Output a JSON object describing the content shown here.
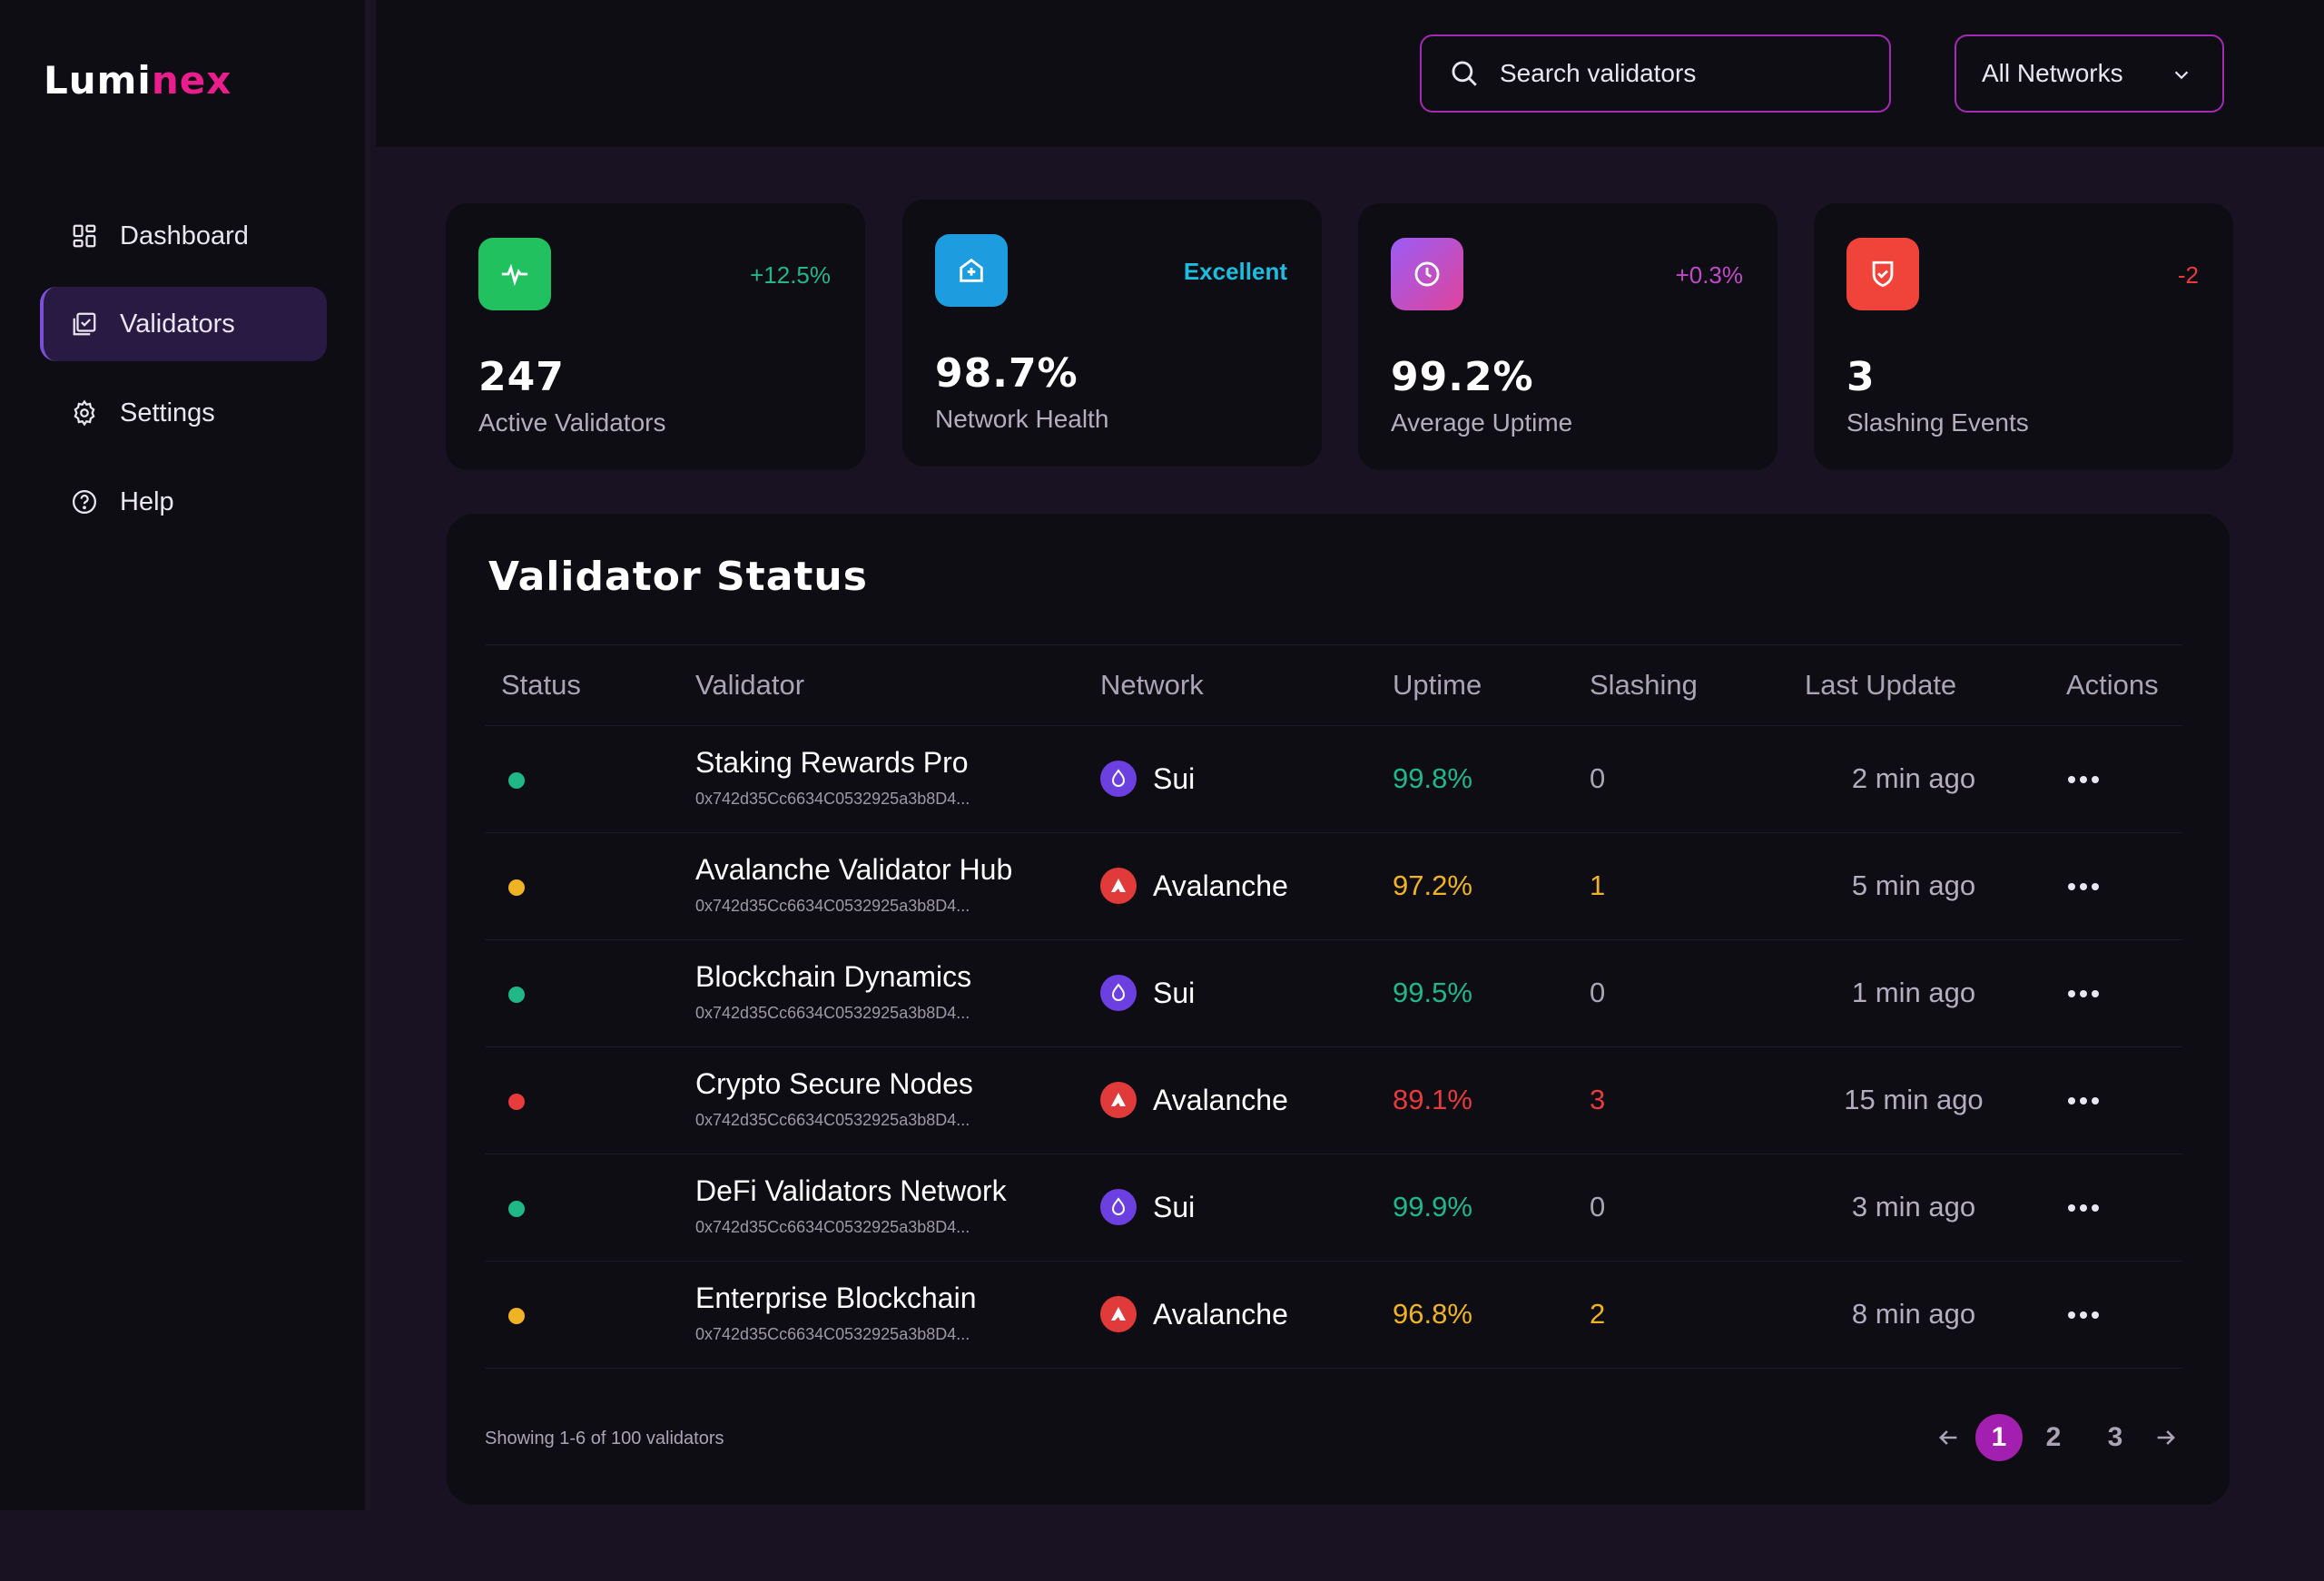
{
  "brand": {
    "name_part1": "Lumi",
    "name_part2": "nex",
    "accent_color": "#e91e8c"
  },
  "sidebar": {
    "items": [
      {
        "label": "Dashboard",
        "icon": "dashboard-icon",
        "active": false
      },
      {
        "label": "Validators",
        "icon": "validators-icon",
        "active": true
      },
      {
        "label": "Settings",
        "icon": "settings-icon",
        "active": false
      },
      {
        "label": "Help",
        "icon": "help-icon",
        "active": false
      }
    ]
  },
  "header": {
    "search_placeholder": "Search validators",
    "network_select": "All Networks"
  },
  "stats": [
    {
      "value": "247",
      "label": "Active Validators",
      "change": "+12.5%",
      "change_color": "#1fb886",
      "icon": "activity-icon",
      "icon_bg": "#22c160"
    },
    {
      "value": "98.7%",
      "label": "Network Health",
      "change": "Excellent",
      "change_color": "#1bbde0",
      "icon": "health-icon",
      "icon_bg": "#1d9de0"
    },
    {
      "value": "99.2%",
      "label": "Average Uptime",
      "change": "+0.3%",
      "change_color": "#c04ac9",
      "icon": "clock-icon",
      "icon_bg": "#b35ad0"
    },
    {
      "value": "3",
      "label": "Slashing Events",
      "change": "-2",
      "change_color": "#e83b3b",
      "icon": "shield-icon",
      "icon_bg": "#f0443a"
    }
  ],
  "table": {
    "title": "Validator Status",
    "columns": [
      "Status",
      "Validator",
      "Network",
      "Uptime",
      "Slashing",
      "Last Update",
      "Actions"
    ],
    "rows": [
      {
        "status": "active",
        "status_color": "#1fb886",
        "name": "Staking Rewards Pro",
        "address": "0x742d35Cc6634C0532925a3b8D4...",
        "network": "Sui",
        "uptime": "99.8%",
        "uptime_color": "#1fb886",
        "slashing": "0",
        "slashing_color": "#aaa4b6",
        "last_update": "2 min ago"
      },
      {
        "status": "warning",
        "status_color": "#f0b323",
        "name": "Avalanche Validator Hub",
        "address": "0x742d35Cc6634C0532925a3b8D4...",
        "network": "Avalanche",
        "uptime": "97.2%",
        "uptime_color": "#f0b323",
        "slashing": "1",
        "slashing_color": "#f0b323",
        "last_update": "5 min ago"
      },
      {
        "status": "active",
        "status_color": "#1fb886",
        "name": "Blockchain Dynamics",
        "address": "0x742d35Cc6634C0532925a3b8D4...",
        "network": "Sui",
        "uptime": "99.5%",
        "uptime_color": "#1fb886",
        "slashing": "0",
        "slashing_color": "#aaa4b6",
        "last_update": "1 min ago"
      },
      {
        "status": "error",
        "status_color": "#e83b3b",
        "name": "Crypto Secure Nodes",
        "address": "0x742d35Cc6634C0532925a3b8D4...",
        "network": "Avalanche",
        "uptime": "89.1%",
        "uptime_color": "#e83b3b",
        "slashing": "3",
        "slashing_color": "#e83b3b",
        "last_update": "15 min ago"
      },
      {
        "status": "active",
        "status_color": "#1fb886",
        "name": "DeFi Validators Network",
        "address": "0x742d35Cc6634C0532925a3b8D4...",
        "network": "Sui",
        "uptime": "99.9%",
        "uptime_color": "#1fb886",
        "slashing": "0",
        "slashing_color": "#aaa4b6",
        "last_update": "3 min ago"
      },
      {
        "status": "warning",
        "status_color": "#f0b323",
        "name": "Enterprise Blockchain",
        "address": "0x742d35Cc6634C0532925a3b8D4...",
        "network": "Avalanche",
        "uptime": "96.8%",
        "uptime_color": "#f0b323",
        "slashing": "2",
        "slashing_color": "#f0b323",
        "last_update": "8 min ago"
      }
    ],
    "footer": "Showing 1-6 of 100 validators",
    "pages": [
      "1",
      "2",
      "3"
    ],
    "current_page": "1"
  }
}
